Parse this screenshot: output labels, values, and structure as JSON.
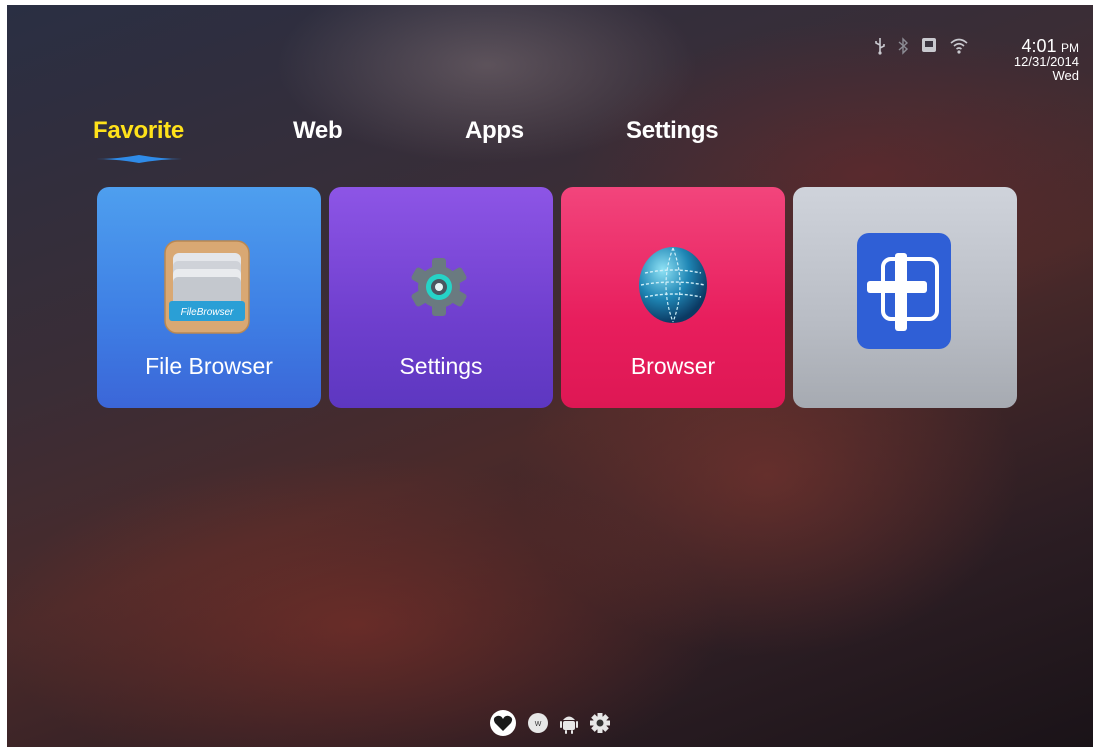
{
  "status_bar": {
    "icons": [
      "usb-icon",
      "bluetooth-icon",
      "ethernet-icon",
      "wifi-icon"
    ],
    "time": "4:01",
    "ampm": "PM",
    "date": "12/31/2014",
    "day": "Wed"
  },
  "tabs": [
    {
      "label": "Favorite",
      "active": true
    },
    {
      "label": "Web",
      "active": false
    },
    {
      "label": "Apps",
      "active": false
    },
    {
      "label": "Settings",
      "active": false
    }
  ],
  "tiles": [
    {
      "label": "File Browser",
      "icon": "file-browser-app-icon",
      "icon_text": "FileBrowser",
      "color": "#4a8ee9"
    },
    {
      "label": "Settings",
      "icon": "settings-gear-icon",
      "color": "#7a45d8"
    },
    {
      "label": "Browser",
      "icon": "globe-icon",
      "color": "#ea2764"
    },
    {
      "label": "",
      "icon": "add-app-icon",
      "color": "#c0c4cc"
    }
  ],
  "dock": [
    "favorite-heart-icon",
    "web-icon",
    "android-apps-icon",
    "settings-gear-icon"
  ],
  "colors": {
    "active_tab": "#ffe21a",
    "indicator": "#2f8be8"
  }
}
